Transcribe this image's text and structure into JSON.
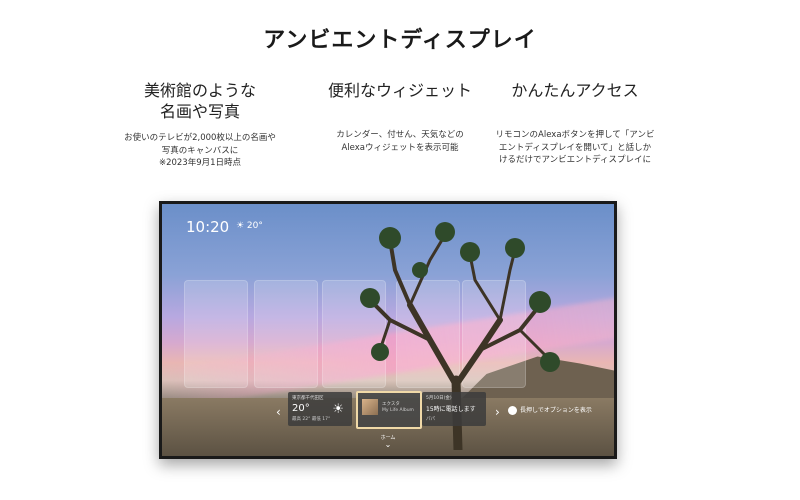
{
  "page": {
    "title": "アンビエントディスプレイ"
  },
  "features": [
    {
      "title_line1": "美術館のような",
      "title_line2": "名画や写真",
      "desc_line1": "お使いのテレビが2,000枚以上の名画や",
      "desc_line2": "写真のキャンバスに",
      "desc_line3": "※2023年9月1日時点"
    },
    {
      "title_line1": "便利なウィジェット",
      "desc_line1": "カレンダー、付せん、天気などの",
      "desc_line2": "Alexaウィジェットを表示可能"
    },
    {
      "title_line1": "かんたんアクセス",
      "desc_line1": "リモコンのAlexaボタンを押して「アンビ",
      "desc_line2": "エントディスプレイを開いて」と話しか",
      "desc_line3": "けるだけでアンビエントディスプレイに"
    }
  ],
  "tv": {
    "clock": "10:20",
    "weather": "☀ 20°",
    "cards": [
      {
        "small": "東京都千代田区",
        "temp": "20°",
        "sub": "最高 22° 最低 17°",
        "icon": "sun-icon"
      },
      {
        "small": "エクスタ",
        "sub": "My Life Album",
        "icon": "album-cover"
      },
      {
        "small": "5月10日(金)",
        "text": "15時に電話します",
        "sub": "パパ"
      }
    ],
    "option_label": "長押しでオプションを表示",
    "home_label": "ホーム"
  },
  "colors": {
    "title_text": "#1a1a1a",
    "tv_bezel": "#1a1a1a",
    "card_highlight": "#f0d9a8"
  }
}
